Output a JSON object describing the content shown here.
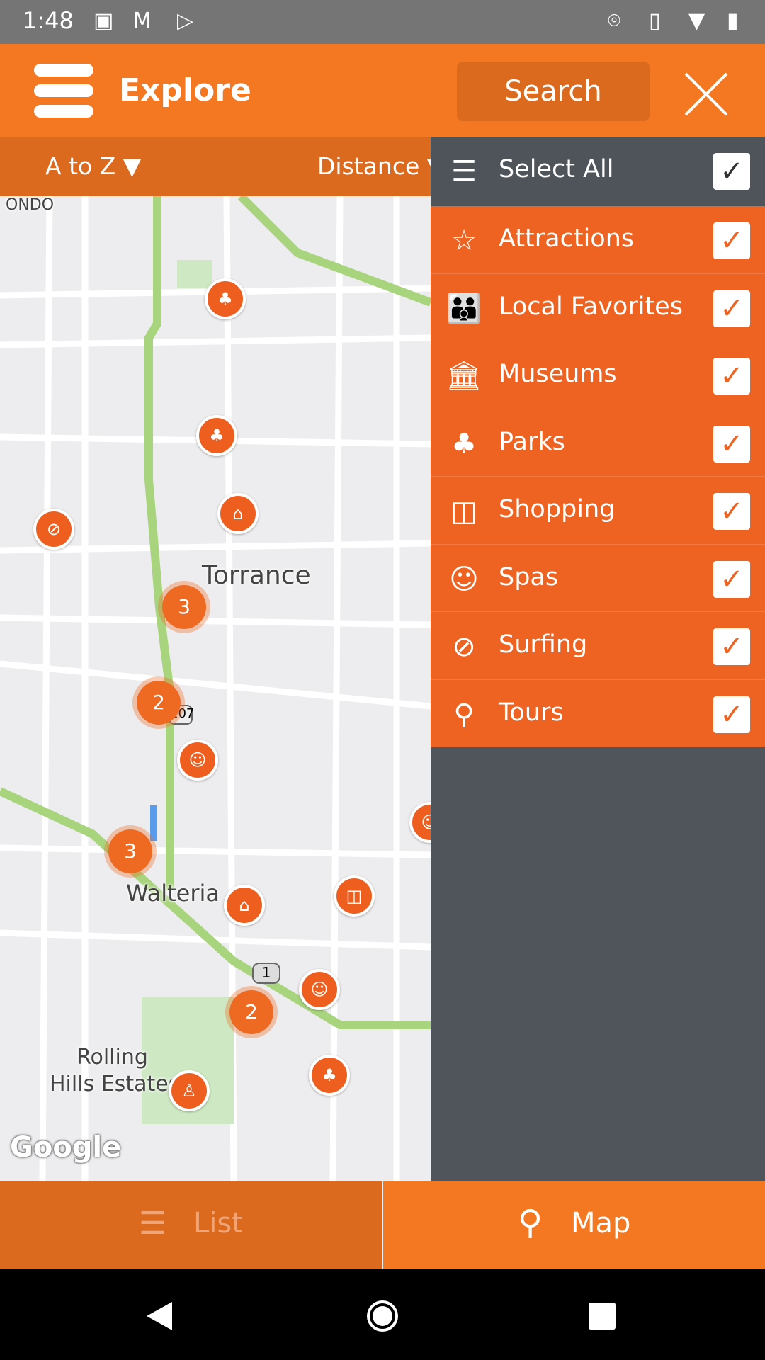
{
  "status_bar": {
    "time": "1:48",
    "left_icons": [
      "image-icon",
      "gmail-icon",
      "play-store-icon"
    ],
    "right_icons": [
      "location-icon",
      "vibrate-icon",
      "wifi-icon",
      "battery-charging-icon"
    ]
  },
  "header": {
    "title": "Explore",
    "search_label": "Search",
    "menu_icon": "hamburger-icon",
    "close_icon": "close-icon"
  },
  "sort_bar": {
    "alpha_label": "A to Z",
    "distance_label": "Distance"
  },
  "map": {
    "labels": {
      "torrance": "Torrance",
      "walteria": "Walteria",
      "rolling_hills_1": "Rolling",
      "rolling_hills_2": "Hills Estates",
      "redondo": "ONDO",
      "route_1": "1",
      "route_107": "107"
    },
    "clusters": [
      "3",
      "2",
      "3",
      "2"
    ],
    "attribution": "Google"
  },
  "filter_panel": {
    "select_all": {
      "label": "Select All",
      "checked": true,
      "icon": "list-edit-icon"
    },
    "categories": [
      {
        "label": "Attractions",
        "checked": true,
        "icon": "star-icon"
      },
      {
        "label": "Local Favorites",
        "checked": true,
        "icon": "family-icon"
      },
      {
        "label": "Museums",
        "checked": true,
        "icon": "museum-icon"
      },
      {
        "label": "Parks",
        "checked": true,
        "icon": "park-bench-icon"
      },
      {
        "label": "Shopping",
        "checked": true,
        "icon": "shopping-bag-icon"
      },
      {
        "label": "Spas",
        "checked": true,
        "icon": "spa-icon"
      },
      {
        "label": "Surfing",
        "checked": true,
        "icon": "surfing-icon"
      },
      {
        "label": "Tours",
        "checked": true,
        "icon": "tour-route-icon"
      }
    ]
  },
  "bottom_tabs": {
    "list_label": "List",
    "map_label": "Map",
    "active": "Map"
  },
  "colors": {
    "brand_orange": "#F47721",
    "dark_orange": "#DB6A1E",
    "panel_gray": "#50555C",
    "row_orange": "#EE6321"
  }
}
